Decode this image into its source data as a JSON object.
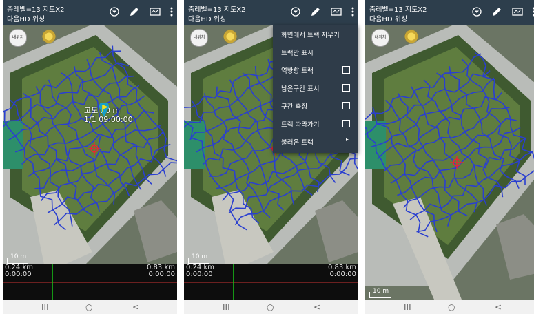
{
  "panels": [
    {
      "zoom_text": "줌레벨=13 지도X2",
      "map_source": "다음HD 위성",
      "scale_label": "10 m",
      "graph_left_km": "0.24 km",
      "graph_left_time": "0:00:00",
      "graph_right_km": "0.83 km",
      "graph_right_time": "0:00:00"
    },
    {
      "zoom_text": "줌레벨=13 지도X2",
      "map_source": "다음HD 위성",
      "scale_label": "10 m",
      "graph_left_km": "0.24 km",
      "graph_left_time": "0:00:00",
      "graph_right_km": "0.83 km",
      "graph_right_time": "0:00:00"
    },
    {
      "zoom_text": "줌레벨=13 지도X2",
      "map_source": "다음HD 위성",
      "scale_label": "10 m"
    }
  ],
  "my_location_label": "내위치",
  "tooltip": {
    "altitude": "고도 : 0 m",
    "datetime": "1/1 09:00:00"
  },
  "menu": [
    {
      "label": "화면에서 트랙 지우기",
      "has_checkbox": false
    },
    {
      "label": "트랙만 표시",
      "has_checkbox": false
    },
    {
      "label": "역방향 트랙",
      "has_checkbox": true
    },
    {
      "label": "남은구간 표시",
      "has_checkbox": true
    },
    {
      "label": "구간 측정",
      "has_checkbox": true
    },
    {
      "label": "트랙 따라가기",
      "has_checkbox": true
    },
    {
      "label": "불러온 트랙",
      "has_submenu": true
    }
  ],
  "nav": {
    "recents": "III",
    "home": "○",
    "back": "<"
  },
  "icons": [
    "dropdown-icon",
    "pencil-icon",
    "map-icon",
    "overflow-menu-icon",
    "compass-icon",
    "crosshair-icon",
    "flag-marker-icon"
  ],
  "colors": {
    "topbar": "#2d3e4c",
    "track": "#2a3fd0",
    "graph_bg": "#0d0d0d",
    "graph_cursor": "#18c418"
  }
}
